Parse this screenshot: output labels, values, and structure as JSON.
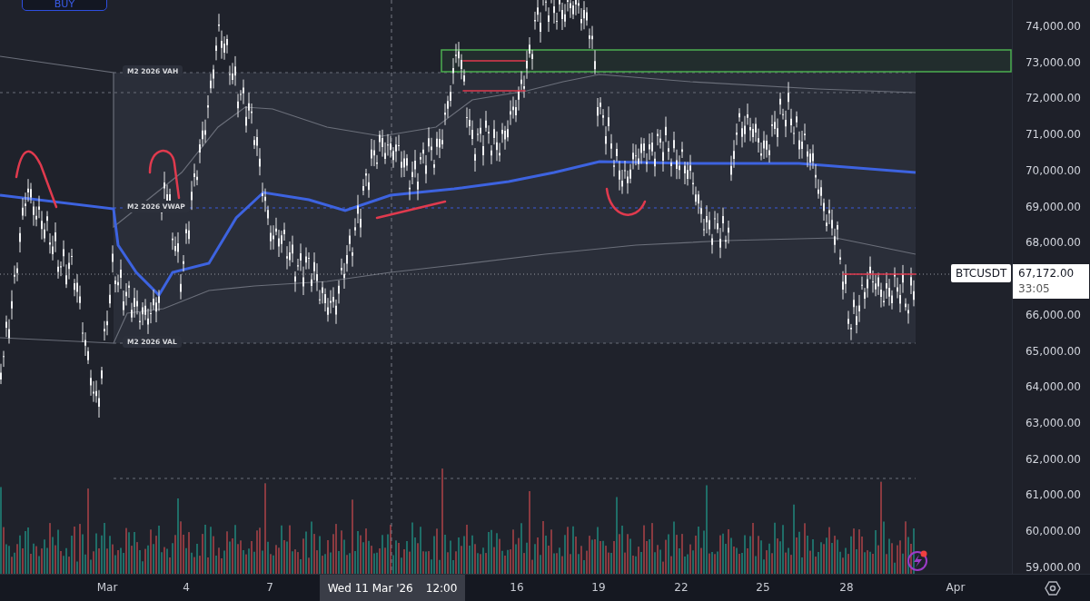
{
  "order_button": {
    "label": "BUY"
  },
  "profile_labels": [
    {
      "kind": "vah",
      "label": "M2 2026 VAH"
    },
    {
      "kind": "vwap",
      "label": "M2 2026 VWAP"
    },
    {
      "kind": "val",
      "label": "M2 2026 VAL"
    }
  ],
  "price_axis": {
    "ticks": [
      "74,000.00",
      "73,000.00",
      "72,000.00",
      "71,000.00",
      "70,000.00",
      "69,000.00",
      "68,000.00",
      "66,000.00",
      "65,000.00",
      "64,000.00",
      "63,000.00",
      "62,000.00",
      "61,000.00",
      "60,000.00",
      "59,000.00"
    ]
  },
  "symbol_tag": "BTCUSDT",
  "last_price": "67,172.00",
  "countdown": "33:05",
  "time_axis": {
    "ticks": [
      "Mar",
      "4",
      "7",
      "16",
      "19",
      "22",
      "25",
      "28",
      "Apr"
    ],
    "crosshair_date": "Wed 11 Mar '26",
    "crosshair_time": "12:00"
  }
}
